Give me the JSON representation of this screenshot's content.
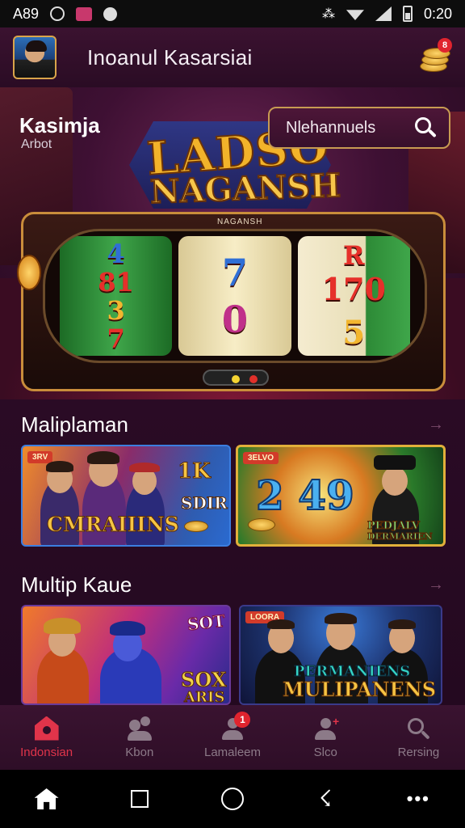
{
  "status_bar": {
    "left_text": "A89",
    "time": "0:20",
    "icons": [
      "circle-icon",
      "photo-icon",
      "gear-icon",
      "vibrate-icon",
      "wifi-icon",
      "signal-icon",
      "battery-icon"
    ]
  },
  "header": {
    "title": "Inoanul Kasarsiai",
    "notification_count": "8"
  },
  "hero": {
    "brand": "Kasimja",
    "brand_sub": "Arbot",
    "search_label": "Nlehannuels",
    "logo_line1": "LADSO",
    "logo_line2": "NAGANSH",
    "slot_label": "NAGANSH",
    "reels": [
      [
        "4",
        "81",
        "3",
        "7"
      ],
      [
        "",
        "7",
        "0",
        ""
      ],
      [
        "R",
        "170",
        "",
        "5"
      ]
    ]
  },
  "sections": [
    {
      "title": "Maliplaman",
      "cards": [
        {
          "tag": "3RV",
          "label": "CMRAIIINS",
          "side_top": "1K",
          "side_bottom": "SDIR"
        },
        {
          "tag": "3ELVO",
          "label_big": "2 49",
          "label_small": "PEDJALV",
          "label_small2": "DERMARIEN"
        }
      ]
    },
    {
      "title": "Multip Kaue",
      "cards": [
        {
          "tag": "",
          "label_top": "SOT",
          "label_bottom": "SOX",
          "label_bottom2": "ARIS"
        },
        {
          "tag": "LOORA",
          "label_top": "PERMANIENS",
          "label_bottom": "MULIPANENS"
        }
      ]
    }
  ],
  "bottom_nav": [
    {
      "label": "Indonsian",
      "icon": "home-icon",
      "active": true
    },
    {
      "label": "Kbon",
      "icon": "people-icon",
      "active": false
    },
    {
      "label": "Lamaleem",
      "icon": "profile-icon",
      "active": false,
      "badge": "1"
    },
    {
      "label": "Slco",
      "icon": "add-user-icon",
      "active": false
    },
    {
      "label": "Rersing",
      "icon": "search-icon",
      "active": false
    }
  ],
  "colors": {
    "accent": "#e0344a",
    "header_bg": "#3b1230",
    "nav_bg": "#2e0e27",
    "gold": "#f2b32a"
  }
}
